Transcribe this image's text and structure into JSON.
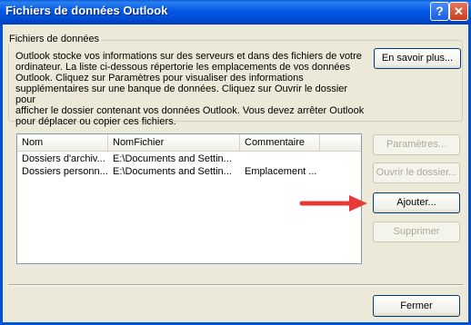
{
  "window": {
    "title": "Fichiers de données Outlook"
  },
  "group": {
    "label": "Fichiers de données",
    "description": [
      "Outlook stocke vos informations sur des serveurs et dans des fichiers de votre",
      "ordinateur. La liste ci-dessous répertorie les emplacements de vos données",
      "Outlook. Cliquez sur Paramètres pour visualiser des informations",
      "supplémentaires sur une banque de données. Cliquez sur Ouvrir le dossier pour",
      "afficher le dossier contenant vos données Outlook. Vous devez arrêter Outlook",
      "pour déplacer ou copier ces fichiers."
    ],
    "learn_more": "En savoir plus..."
  },
  "table": {
    "columns": [
      "Nom",
      "NomFichier",
      "Commentaire"
    ],
    "rows": [
      [
        "Dossiers d'archiv...",
        "E:\\Documents and Settin...",
        ""
      ],
      [
        "Dossiers personn...",
        "E:\\Documents and Settin...",
        "Emplacement ..."
      ]
    ]
  },
  "buttons": {
    "settings": "Paramètres...",
    "open_folder": "Ouvrir le dossier...",
    "add": "Ajouter...",
    "remove": "Supprimer",
    "close": "Fermer"
  },
  "annotation": {
    "arrow_color": "#e83a3a"
  },
  "colors": {
    "title_bar": "#0058e6",
    "dialog_bg": "#ece9d8"
  }
}
